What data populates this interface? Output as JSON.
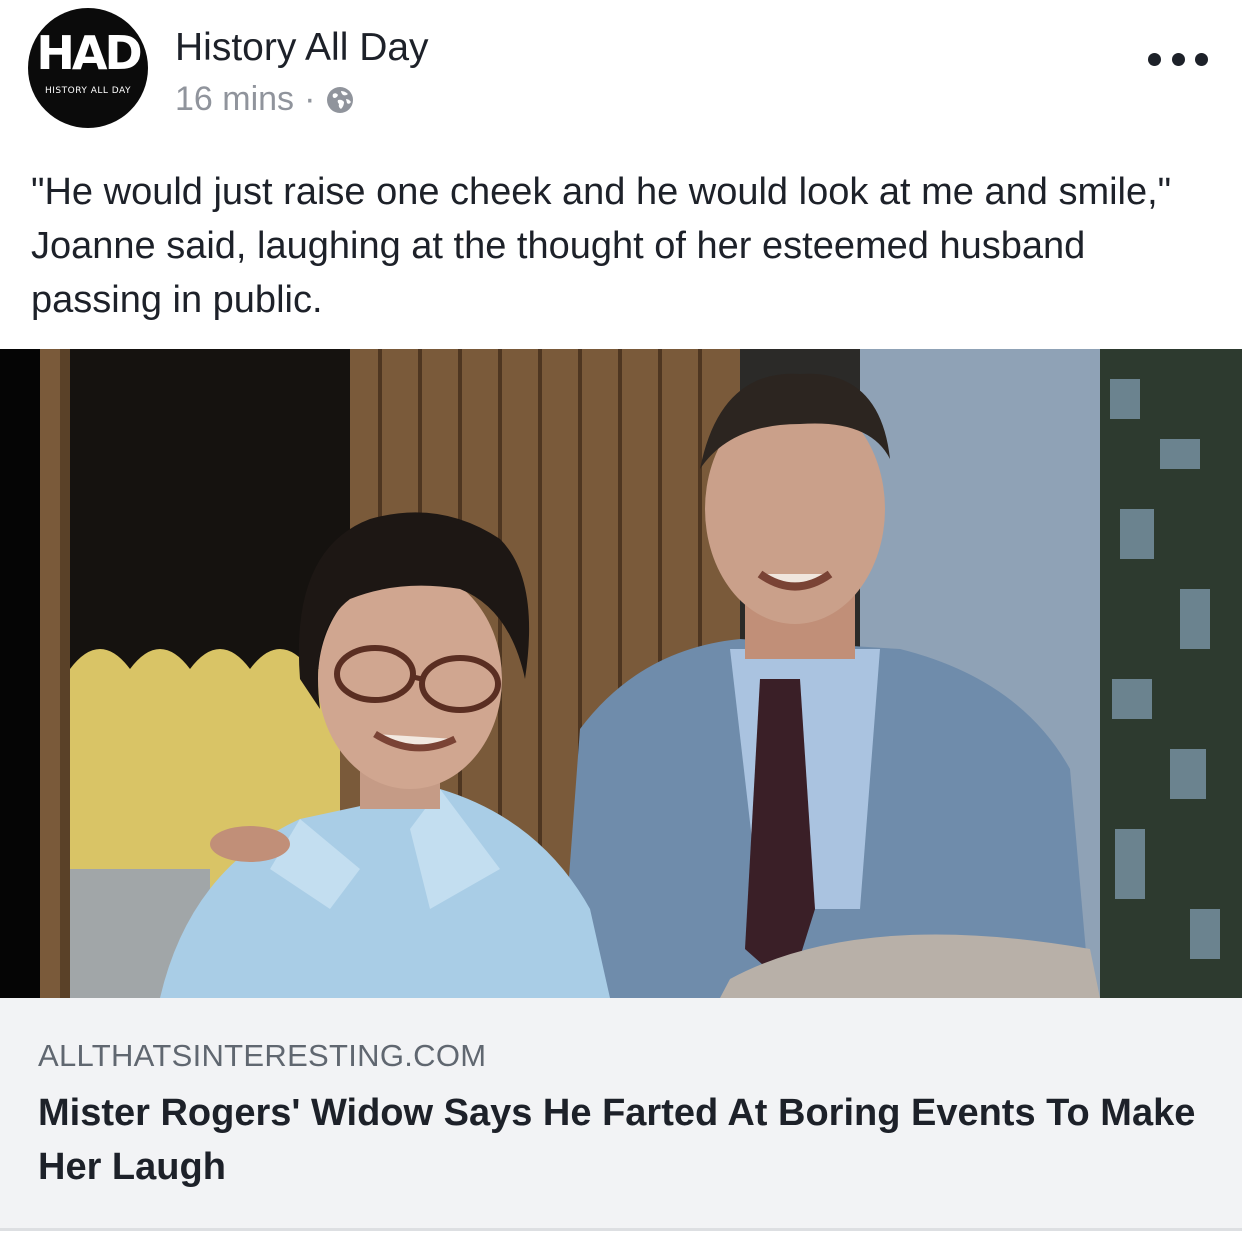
{
  "page": {
    "name": "History All Day",
    "logo_text": "HAD",
    "logo_subtext": "HISTORY ALL DAY",
    "time": "16 mins",
    "separator": "·",
    "privacy_icon": "globe-icon",
    "more_icon": "ellipsis-icon"
  },
  "post": {
    "caption": "\"He would just raise one cheek and he would look at me and smile,\" Joanne said, laughing at the thought of her esteemed husband passing in public."
  },
  "link": {
    "domain": "ALLTHATSINTERESTING.COM",
    "title": "Mister Rogers' Widow Says He Farted At Boring Events To Make Her Laugh"
  },
  "colors": {
    "text_primary": "#1d2129",
    "text_secondary": "#90949c",
    "link_background": "#f2f3f5",
    "avatar_background": "#0b0b0b"
  }
}
